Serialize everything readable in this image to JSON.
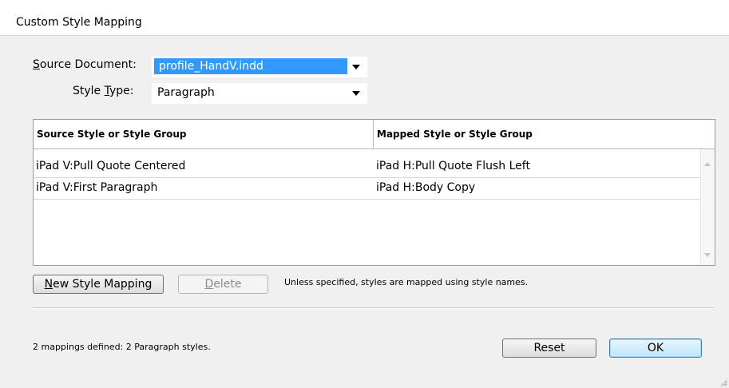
{
  "window": {
    "title": "Custom Style Mapping"
  },
  "source_document": {
    "label_prefix": "",
    "label_underlined": "S",
    "label_rest": "ource Document:",
    "value": "profile_HandV.indd"
  },
  "style_type": {
    "label_prefix": "Style ",
    "label_underlined": "T",
    "label_rest": "ype:",
    "value": "Paragraph"
  },
  "table": {
    "headers": [
      "Source Style or Style Group",
      "Mapped Style or Style Group"
    ],
    "rows": [
      {
        "source": "iPad V:Pull Quote Centered",
        "mapped": "iPad H:Pull Quote Flush Left"
      },
      {
        "source": "iPad V:First Paragraph",
        "mapped": "iPad H:Body Copy"
      }
    ]
  },
  "buttons": {
    "new_mapping": {
      "underlined": "N",
      "rest": "ew Style Mapping"
    },
    "delete": {
      "underlined": "D",
      "rest": "elete"
    },
    "reset": "Reset",
    "ok": "OK"
  },
  "note": "Unless specified, styles are mapped using style names.",
  "status": "2 mappings defined:  2 Paragraph styles.",
  "colors": {
    "selection": "#3399ff",
    "dialog_bg": "#f0f0f0"
  },
  "icons": {
    "dropdown": "chevron-down-icon",
    "scroll_up": "scroll-up-icon",
    "scroll_down": "scroll-down-icon",
    "resize": "resize-grip-icon"
  }
}
